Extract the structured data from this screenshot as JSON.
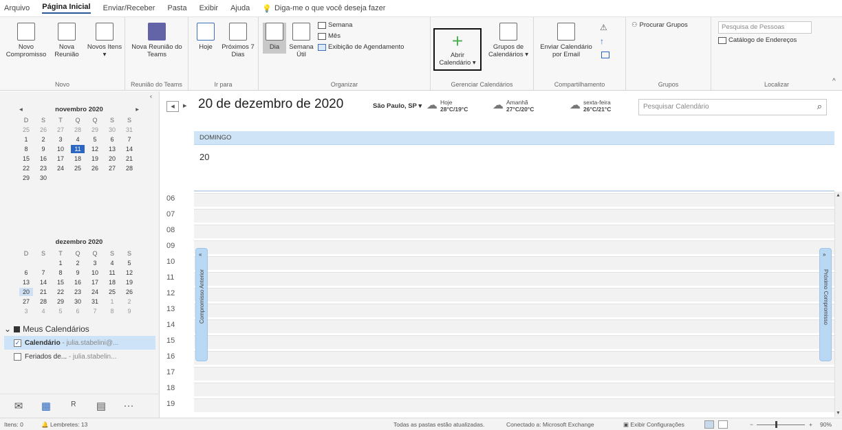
{
  "menu": {
    "tabs": [
      "Arquivo",
      "Página Inicial",
      "Enviar/Receber",
      "Pasta",
      "Exibir",
      "Ajuda"
    ],
    "tellme": "Diga-me o que você deseja fazer"
  },
  "ribbon": {
    "novo": {
      "novo_compromisso": "Novo Compromisso",
      "nova_reuniao": "Nova Reunião",
      "novos_itens": "Novos Itens ▾",
      "label": "Novo"
    },
    "teams": {
      "nova_reuniao_teams": "Nova Reunião do Teams",
      "label": "Reunião do Teams"
    },
    "irpara": {
      "hoje": "Hoje",
      "proximos": "Próximos 7 Dias",
      "label": "Ir para"
    },
    "organizar": {
      "dia": "Dia",
      "semana_util": "Semana Útil",
      "semana": "Semana",
      "mes": "Mês",
      "agendamento": "Exibição de Agendamento",
      "label": "Organizar"
    },
    "gerenciar": {
      "abrir": "Abrir Calendário ▾",
      "grupos": "Grupos de Calendários ▾",
      "label": "Gerenciar Calendários"
    },
    "compartilhamento": {
      "enviar": "Enviar Calendário por Email",
      "label": "Compartilhamento"
    },
    "grupos": {
      "procurar": "Procurar Grupos",
      "label": "Grupos"
    },
    "localizar": {
      "pesquisa_placeholder": "Pesquisa de Pessoas",
      "catalogo": "Catálogo de Endereços",
      "label": "Localizar"
    }
  },
  "minical": {
    "dow": [
      "D",
      "S",
      "T",
      "Q",
      "Q",
      "S",
      "S"
    ],
    "months": [
      {
        "title": "novembro 2020",
        "days": [
          [
            "25",
            "26",
            "27",
            "28",
            "29",
            "30",
            "31"
          ],
          [
            "1",
            "2",
            "3",
            "4",
            "5",
            "6",
            "7"
          ],
          [
            "8",
            "9",
            "10",
            "11",
            "12",
            "13",
            "14"
          ],
          [
            "15",
            "16",
            "17",
            "18",
            "19",
            "20",
            "21"
          ],
          [
            "22",
            "23",
            "24",
            "25",
            "26",
            "27",
            "28"
          ],
          [
            "29",
            "30",
            "",
            "",
            "",
            "",
            ""
          ]
        ]
      },
      {
        "title": "dezembro 2020",
        "days": [
          [
            "",
            "",
            "1",
            "2",
            "3",
            "4",
            "5"
          ],
          [
            "6",
            "7",
            "8",
            "9",
            "10",
            "11",
            "12"
          ],
          [
            "13",
            "14",
            "15",
            "16",
            "17",
            "18",
            "19"
          ],
          [
            "20",
            "21",
            "22",
            "23",
            "24",
            "25",
            "26"
          ],
          [
            "27",
            "28",
            "29",
            "30",
            "31",
            "1",
            "2"
          ],
          [
            "3",
            "4",
            "5",
            "6",
            "7",
            "8",
            "9"
          ]
        ]
      }
    ]
  },
  "mycals": {
    "header": "Meus Calendários",
    "items": [
      {
        "name": "Calendário",
        "account": " - julia.stabelini@...",
        "checked": true
      },
      {
        "name": "Feriados de...",
        "account": " - julia.stabelin...",
        "checked": false
      }
    ]
  },
  "calendar": {
    "title": "20 de dezembro de 2020",
    "location": "São Paulo, SP ▾",
    "weather": [
      {
        "label": "Hoje",
        "temp": "28°C/19°C"
      },
      {
        "label": "Amanhã",
        "temp": "27°C/20°C"
      },
      {
        "label": "sexta-feira",
        "temp": "26°C/21°C"
      }
    ],
    "search_placeholder": "Pesquisar Calendário",
    "day_header": "DOMINGO",
    "day_number": "20",
    "hours": [
      "06",
      "07",
      "08",
      "09",
      "10",
      "11",
      "12",
      "13",
      "14",
      "15",
      "16",
      "17",
      "18",
      "19"
    ],
    "prev_label": "Compromisso Anterior",
    "next_label": "Próximo Compromisso"
  },
  "status": {
    "items": "Itens: 0",
    "reminders": "Lembretes: 13",
    "sync": "Todas as pastas estão atualizadas.",
    "connected": "Conectado a: Microsoft Exchange",
    "display": "Exibir Configurações",
    "zoom": "90%"
  }
}
